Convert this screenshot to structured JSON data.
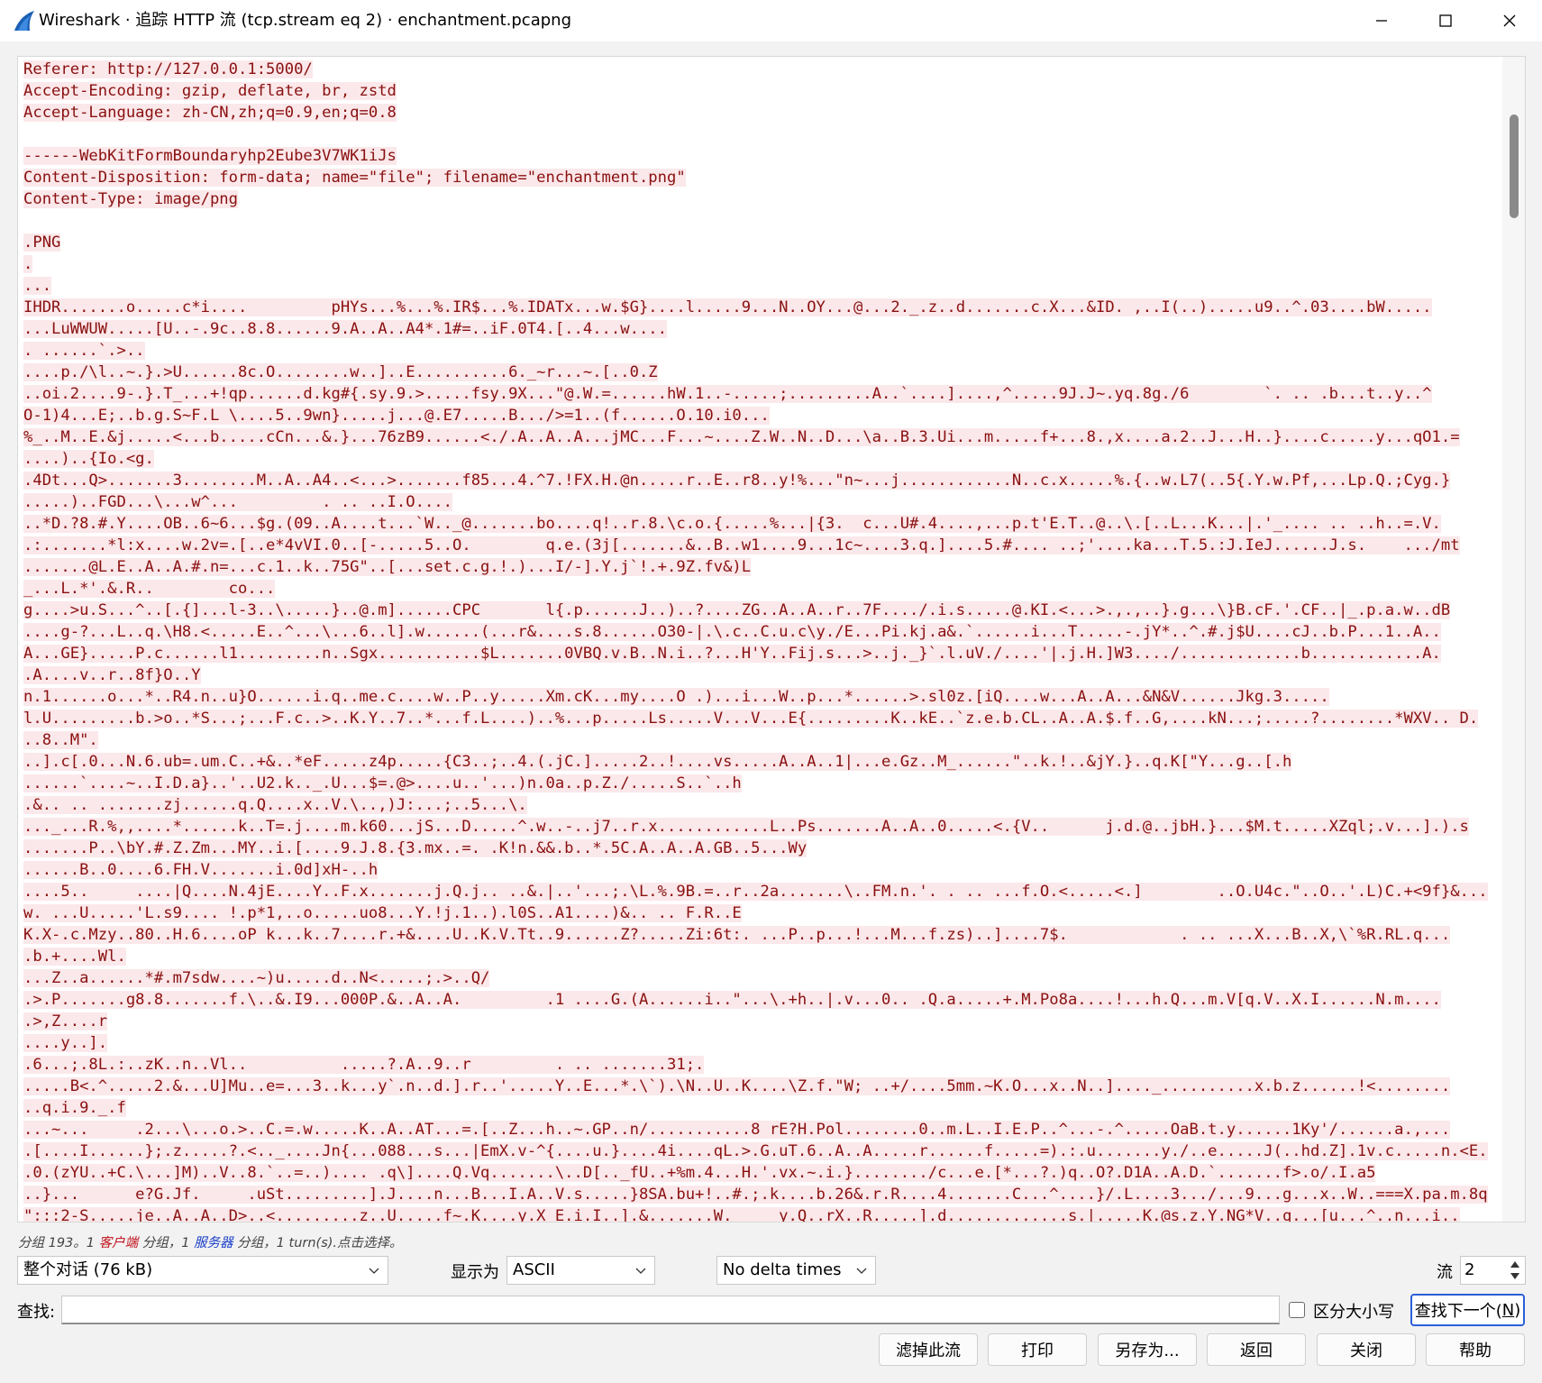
{
  "window": {
    "title": "Wireshark · 追踪 HTTP 流 (tcp.stream eq 2) · enchantment.pcapng",
    "icon": "wireshark-fin-icon",
    "controls": [
      "minimize-icon",
      "maximize-icon",
      "close-icon"
    ]
  },
  "stream": {
    "lines": [
      "Referer: http://127.0.0.1:5000/",
      "Accept-Encoding: gzip, deflate, br, zstd",
      "Accept-Language: zh-CN,zh;q=0.9,en;q=0.8",
      "",
      "------WebKitFormBoundaryhp2Eube3V7WK1iJs",
      "Content-Disposition: form-data; name=\"file\"; filename=\"enchantment.png\"",
      "Content-Type: image/png",
      "",
      ".PNG",
      ".",
      "...",
      "IHDR.......o.....c*i....         pHYs...%...%.IR$...%.IDATx...w.$G}....l.....9...N..OY...@...2._.z..d.......c.X...&ID. ,..I(..).....u9..^.03....bW.....",
      "...LuWWUW.....[U..-.9c..8.8......9.A..A..A4*.1#=..iF.0T4.[..4...w....",
      ". ......`.>..",
      "....p./\\l..~.}.>U......8c.O........w..]..E..........6._~r...~.[..0.Z",
      "..oi.2....9-.}.T_...+!qp......d.kg#{.sy.9.>.....fsy.9X...\"@.W.=......hW.1..-.....;.........A..`....]....,^.....9J.J~.yq.8g./6        `. .. .b...t..y..^",
      "O-1)4...E;..b.g.S~F.L \\....5..9wn}.....j...@.E7.....B.../>=1..(f......O.10.i0...",
      "%_..M..E.&j.....<...b.....cCn...&.}...76zB9......<./.A..A..A...jMC...F...~....Z.W..N..D...\\a..B.3.Ui...m.....f+...8.,x....a.2..J...H..}....c.....y...qO1.=",
      "....)..{Io.<g.",
      ".4Dt...Q>.......3........M..A..A4..<...>.......f85...4.^7.!FX.H.@n.....r..E..r8..y!%...\"n~...j............N..c.x.....%.{..w.L7(..5{.Y.w.Pf,...Lp.Q.;Cyg.}",
      ".....)..FGD...\\...w^...         . .. ..I.O....",
      "..*D.?8.#.Y....OB..6~6...$g.(09..A....t...`W.._@.......bo....q!..r.8.\\c.o.{.....%...|{3.  c...U#.4....,...p.t'E.T..@..\\.[..L...K...|.'_.... .. ..h..=.V.",
      ".:.......*l:x....w.2v=.[..e*4vVI.0..[-.....5..O.        q.e.(3j[.......&..B..w1....9...1c~....3.q.]....5.#.... ..;'....ka...T.5.:J.IeJ......J.s.    .../mt",
      ".......@L.E..A..A.#.n=...c.1..k..75G\"..[...set.c.g.!.)...I/-].Y.j`!.+.9Z.fv&)L",
      "_...L.*'.&.R..        co...",
      "g....>u.S...^..[.{]...l-3..\\.....}..@.m]......CPC       l{.p......J..)..?....ZG..A..A..r..7F..../.i.s.....@.KI.<...>.,.,..}.g...\\}B.cF.'.CF..|_.p.a.w..dB",
      "....g-?...L..q.\\H8.<.....E..^...\\...6..l].w......(...r&....s.8......O30-|.\\.c..C.u.c\\y./E...Pi.kj.a&.`......i...T.....-.jY*..^.#.j$U....cJ..b.P...1..A..",
      "A...GE}.....P.c......l1.........n..Sgx...........$L.......0VBQ.v.B..N.i..?...H'Y..Fij.s...>..j._}`.l.uV./....'|.j.H.]W3..../.............b............A.",
      ".A....v..r..8f}O..Y",
      "n.1......o...*..R4.n..u}O......i.q..me.c....w..P..y.....Xm.cK...my....O .)...i...W..p...*......>.sl0z.[iQ....w...A..A...&N&V......Jkg.3.....",
      "l.U.........b.>o..*S...;...F.c..>..K.Y..7..*...f.L....)..%...p.....Ls.....V...V...E{.........K..kE..`z.e.b.CL..A..A.$.f..G,....kN...;.....?........*WXV.. D.",
      "..8..M\".",
      "..].c[.0...N.6.ub=.um.C..+&..*eF.....z4p.....{C3..;..4.(.jC.].....2..!....vs.....A..A..1|...e.Gz..M_......\"..k.!..&jY.}..q.K[\"Y...g..[.h",
      "......`....~..I.D.a}..'..U2.k.._.U...$=.@>....u..'...)n.0a..p.Z./.....S..`..h",
      ".&.. .. .......zj......q.Q....x..V.\\..,)J:...;..5...\\.",
      "..._...R.%,,....*......k..T=.j....m.k60...jS...D.....^.w..-..j7..r.x............L..Ps.......A..A..0.....<.{V..      j.d.@..jbH.}...$M.t.....XZql;.v...].).s",
      ".......P..\\bY.#.Z.Zm...MY..i.[....9.J.8.{3.mx..=. .K!n.&&.b..*.5C.A..A..A.GB..5...Wy",
      "......B..0....6.FH.V.......i.0d]xH-..h",
      "....5..     ....|Q....N.4jE....Y..F.x.......j.Q.j.. ..&.|..'...;.\\L.%.9B.=..r..2a.......\\..FM.n.'. . .. ...f.O.<.....<.]        ..O.U4c.\"..O..'.L)C.+<9f}&...",
      "w. ...U.....'L.s9.... !.p*1,..o.....uo8...Y.!j.1..).l0S..A1....)&.. .. F.R..E",
      "K.X-.c.Mzy..80..H.6....oP k...k..7....r.+&....U..K.V.Tt..9......Z?.....Zi:6t:. ...P..p...!...M...f.zs)..]....7$.            . .. ...X...B..X,\\`%R.RL.q...",
      ".b.+....Wl.",
      "...Z..a......*#.m7sdw....~)u.....d..N<.....;.>..Q/",
      ".>.P.......g8.8.......f.\\..&.I9...000P.&..A..A.         .1 ....G.(A......i..\"...\\.+h..|.v...0.. .Q.a.....+.M.Po8a....!...h.Q...m.V[q.V..X.I......N.m....",
      ".>,Z....r",
      "....y..].",
      ".6...;.8L.:..zK..n..Vl..          .....?.A..9..r         . .. .......31;.",
      ".....B<.^.....2.&...U]Mu..e=...3..k...y`.n..d.].r..'.....Y..E...*.\\`).\\N..U..K....\\Z.f.\"W; ..+/....5mm.~K.O...x..N..]...._..........x.b.z......!<........",
      "..q.i.9._.f",
      "...~...     .2...\\...o.>..C.=.w.....K..A..AT...=.[..Z...h..~.GP..n/...........8 rE?H.Pol........0..m.L..I.E.P..^...-.^.....OaB.t.y......1Ky'/......a.,...",
      ".[....I......};.z.....?.<.._....Jn{...088...s...|EmX.v-^{....u.}....4i....qL.>.G.uT.6..A..A.....r......f.....=).:.u.......y./..e.....J(..hd.Z].1v.c.....n.<E.",
      ".0.(zYU..+C.\\...]M)..V..8.`..=..).... .q\\]....Q.Vq.......\\..D[.._fU..+%m.4...H.'.vx.~.i.}......../c...e.[*...?.)q..O?.D1A..A.D.`.......f>.o/.I.a5",
      "..}...      e?G.Jf.     .uSt.........].J....n...B...I.A..V.s.....}8SA.bu+!..#.;.k....b.26&.r.R....4.......C...^....}/.L....3.../...9...g...x..W..===X.pa.m.8q",
      "\":::2-S.....je..A..A..D>..<.........z..U.....f~.K....y.X E.i.I..].&.......W.     y.Q..rX..R.....].d.............s.|.....K.@s.z.Y.NG*V..q...[u...^..n...i.."
    ]
  },
  "status": {
    "prefix": "分组 193。1 ",
    "client_link": "客户端",
    "middle": " 分组，1 ",
    "server_link": "服务器",
    "suffix": " 分组，1 turn(s).点击选择。"
  },
  "controls": {
    "conversation_value": "整个对话 (76 kB)",
    "show_as_label": "显示为",
    "show_as_value": "ASCII",
    "delta_value": "No delta times",
    "stream_label": "流",
    "stream_value": "2"
  },
  "find": {
    "label": "查找:",
    "value": "",
    "case_label": "区分大小写",
    "case_checked": false,
    "next_label": "查找下一个(",
    "next_accel": "N",
    "next_close": ")"
  },
  "buttons": {
    "filter": "滤掉此流",
    "print": "打印",
    "save_as": "另存为...",
    "back": "返回",
    "close": "关闭",
    "help": "帮助"
  },
  "colors": {
    "client_text": "#8a1010",
    "client_bg": "#fbe8ea",
    "client_link": "#c0101a",
    "server_link": "#1a3fc9",
    "accent": "#2a5fd8"
  }
}
